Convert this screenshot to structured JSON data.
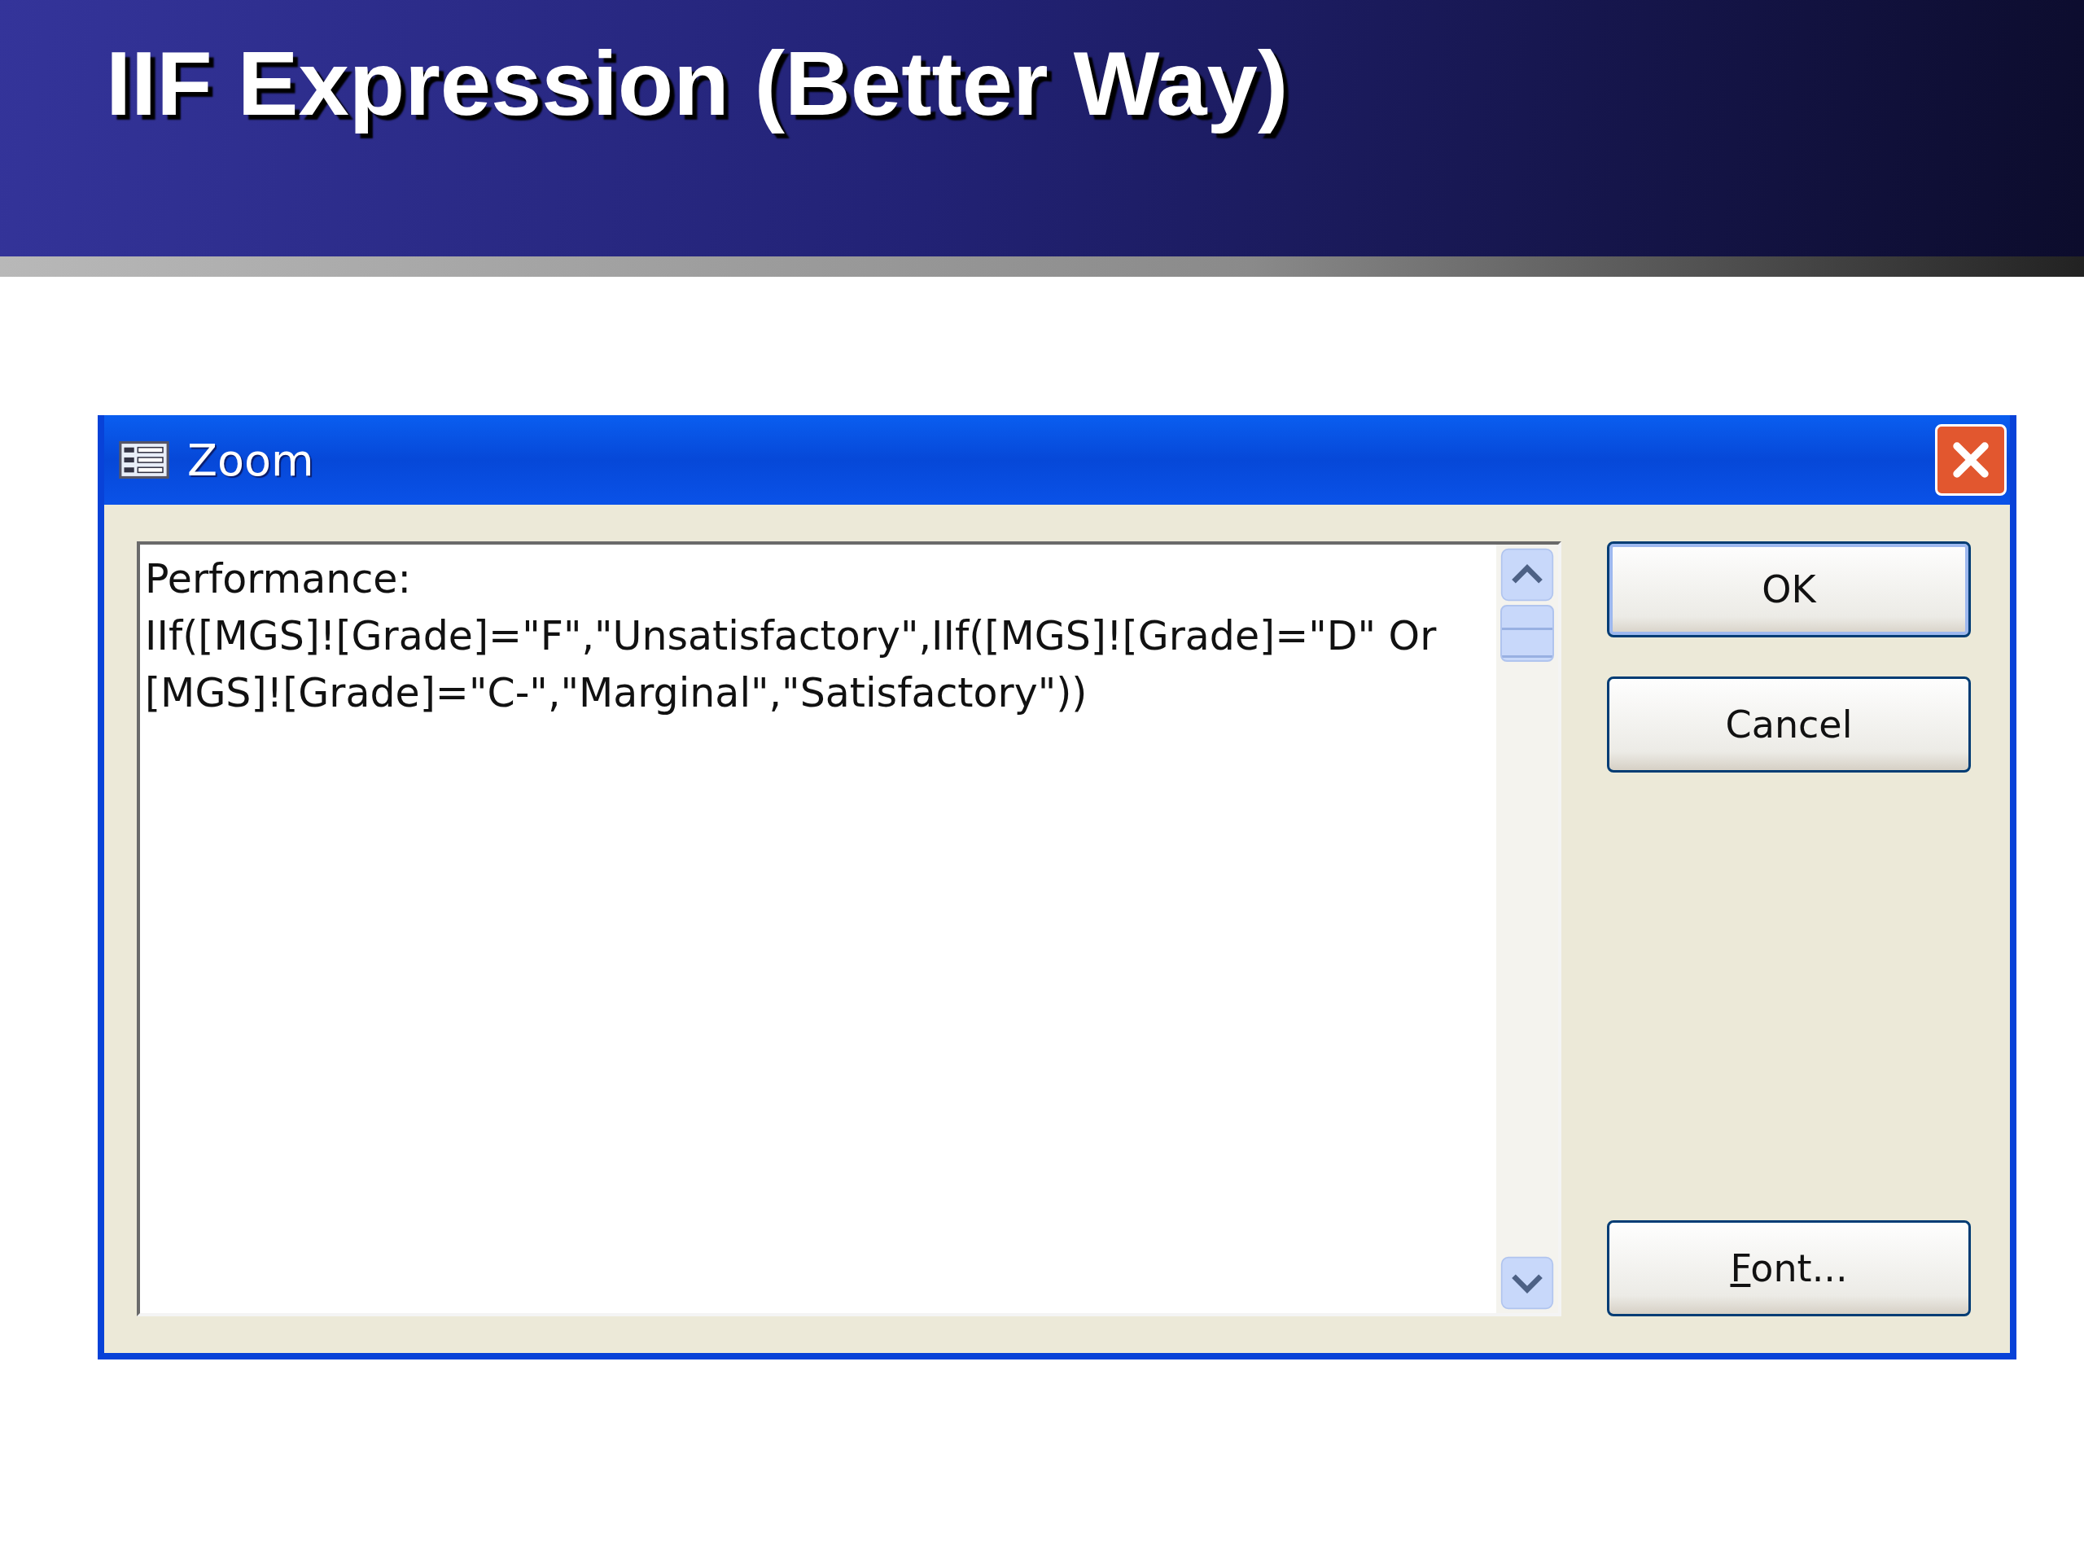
{
  "slide_title": "IIF Expression (Better Way)",
  "dialog": {
    "title": "Zoom",
    "expression_lines": [
      "Performance:",
      "IIf([MGS]![Grade]=\"F\",\"Unsatisfactory\",IIf([MGS]![Grade]=\"D\" Or",
      "[MGS]![Grade]=\"C-\",\"Marginal\",\"Satisfactory\"))"
    ],
    "buttons": [
      {
        "label": "OK",
        "kind": "default",
        "first_letter_underlined": false
      },
      {
        "label": "Cancel",
        "kind": "normal",
        "first_letter_underlined": false
      },
      {
        "label": "Font...",
        "kind": "normal",
        "first_letter_underlined": true
      }
    ]
  }
}
